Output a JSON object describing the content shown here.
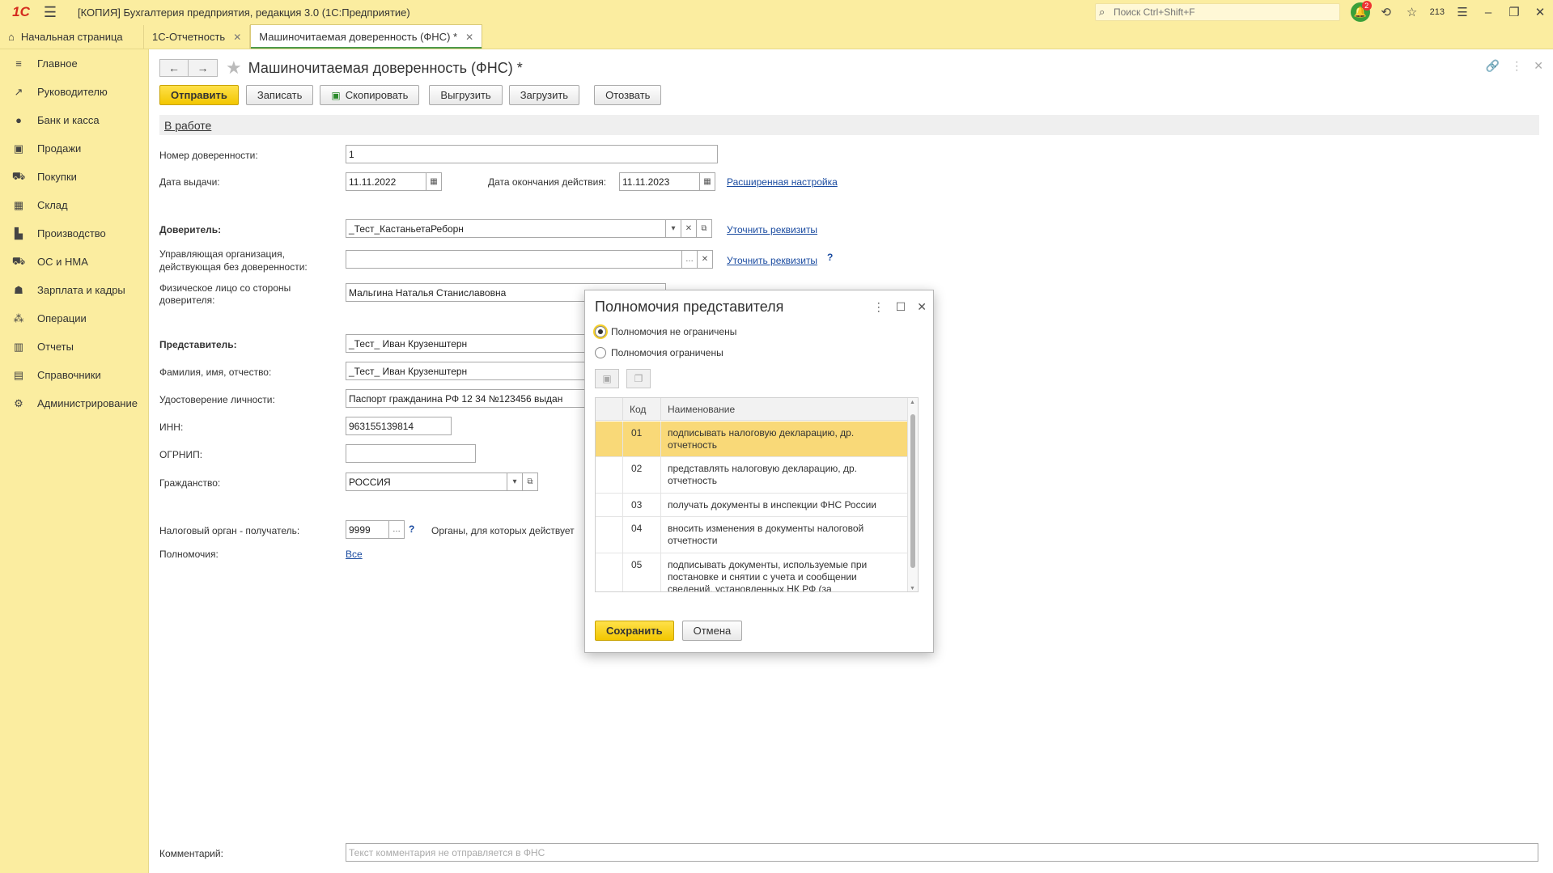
{
  "titlebar": {
    "logo": "1С",
    "app_title": "[КОПИЯ] Бухгалтерия предприятия, редакция 3.0  (1С:Предприятие)",
    "search_placeholder": "Поиск Ctrl+Shift+F",
    "notify_badge": "2",
    "notify_count": "213"
  },
  "tabs": [
    {
      "label": "Начальная страница"
    },
    {
      "label": "1С-Отчетность"
    },
    {
      "label": "Машиночитаемая доверенность (ФНС) *"
    }
  ],
  "sidebar": {
    "items": [
      {
        "label": "Главное",
        "icon": "menu-icon"
      },
      {
        "label": "Руководителю",
        "icon": "trend-icon"
      },
      {
        "label": "Банк и касса",
        "icon": "bank-icon"
      },
      {
        "label": "Продажи",
        "icon": "bag-icon"
      },
      {
        "label": "Покупки",
        "icon": "cart-icon"
      },
      {
        "label": "Склад",
        "icon": "warehouse-icon"
      },
      {
        "label": "Производство",
        "icon": "factory-icon"
      },
      {
        "label": "ОС и НМА",
        "icon": "truck-icon"
      },
      {
        "label": "Зарплата и кадры",
        "icon": "person-icon"
      },
      {
        "label": "Операции",
        "icon": "operations-icon"
      },
      {
        "label": "Отчеты",
        "icon": "report-icon"
      },
      {
        "label": "Справочники",
        "icon": "book-icon"
      },
      {
        "label": "Администрирование",
        "icon": "gear-icon"
      }
    ]
  },
  "form": {
    "title": "Машиночитаемая доверенность (ФНС) *",
    "buttons": {
      "send": "Отправить",
      "save": "Записать",
      "copy": "Скопировать",
      "export": "Выгрузить",
      "import": "Загрузить",
      "revoke": "Отозвать"
    },
    "status": "В работе",
    "fields": {
      "number_label": "Номер доверенности:",
      "number_value": "1",
      "issue_date_label": "Дата выдачи:",
      "issue_date_value": "11.11.2022",
      "end_date_label": "Дата окончания действия:",
      "end_date_value": "11.11.2023",
      "advanced_link": "Расширенная настройка",
      "principal_label": "Доверитель:",
      "principal_value": "_Тест_КастаньетаРеборн",
      "clarify_link": "Уточнить реквизиты",
      "managing_org_label_1": "Управляющая организация,",
      "managing_org_label_2": "действующая без доверенности:",
      "managing_org_value": "",
      "clarify_link_2": "Уточнить реквизиты",
      "individual_label_1": "Физическое лицо со стороны",
      "individual_label_2": "доверителя:",
      "individual_value": "Мальгина Наталья Станиславовна",
      "representative_label": "Представитель:",
      "representative_value": "_Тест_ Иван Крузенштерн",
      "fio_label": "Фамилия, имя, отчество:",
      "fio_value": "_Тест_ Иван Крузенштерн",
      "id_doc_label": "Удостоверение личности:",
      "id_doc_value": "Паспорт гражданина РФ 12 34 №123456 выдан",
      "inn_label": "ИНН:",
      "inn_value": "963155139814",
      "ogrnip_label": "ОГРНИП:",
      "ogrnip_value": "",
      "citizenship_label": "Гражданство:",
      "citizenship_value": "РОССИЯ",
      "tax_authority_label": "Налоговый орган - получатель:",
      "tax_authority_value": "9999",
      "organs_text": "Органы, для которых действует",
      "powers_label": "Полномочия:",
      "powers_link": "Все",
      "comment_label": "Комментарий:",
      "comment_placeholder": "Текст комментария не отправляется в ФНС"
    }
  },
  "dialog": {
    "title": "Полномочия представителя",
    "radio_unlimited": "Полномочия не ограничены",
    "radio_limited": "Полномочия ограничены",
    "selected": "unlimited",
    "columns": {
      "code": "Код",
      "name": "Наименование"
    },
    "rows": [
      {
        "code": "01",
        "name": "подписывать налоговую декларацию, др. отчетность"
      },
      {
        "code": "02",
        "name": "представлять налоговую декларацию, др. отчетность"
      },
      {
        "code": "03",
        "name": "получать документы в инспекции ФНС России"
      },
      {
        "code": "04",
        "name": "вносить изменения в документы налоговой отчетности"
      },
      {
        "code": "05",
        "name": "подписывать документы, используемые при постановке и снятии с учета и сообщении сведений, установленных НК РФ (за"
      }
    ],
    "save": "Сохранить",
    "cancel": "Отмена"
  },
  "colors": {
    "panel": "#fbeda0",
    "primary_button": "#f2c600",
    "selected_row": "#f9d978",
    "link": "#1a4ba0"
  }
}
